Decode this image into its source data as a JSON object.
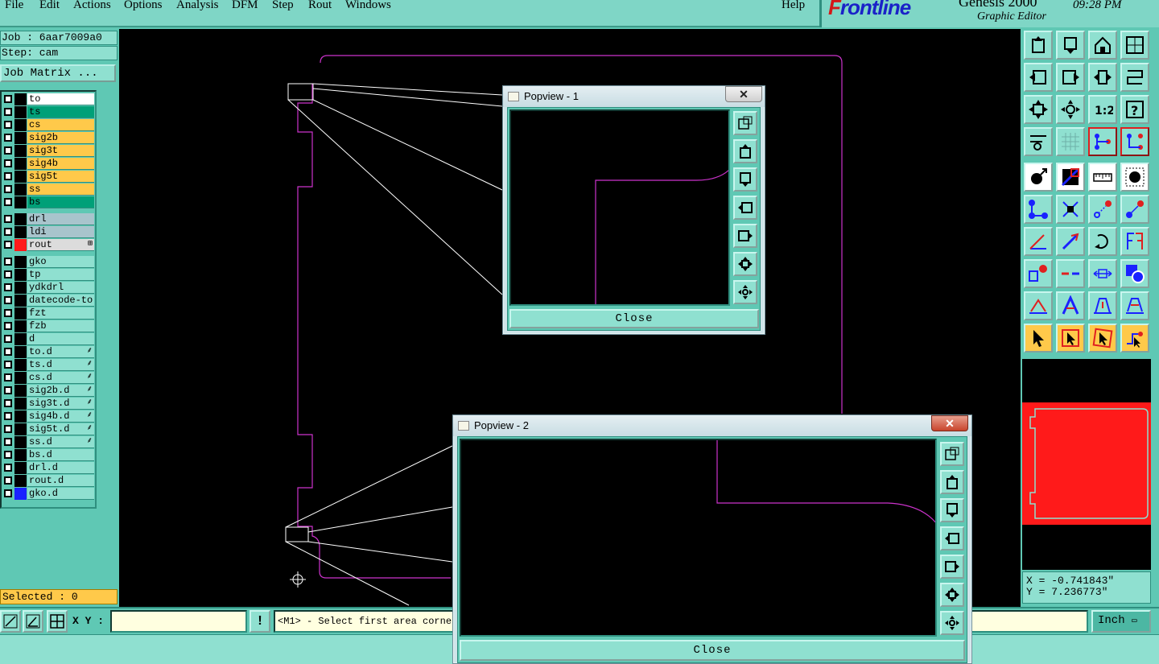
{
  "menubar": {
    "items": [
      {
        "label": "File",
        "u": "F"
      },
      {
        "label": "Edit",
        "u": "E"
      },
      {
        "label": "Actions",
        "u": "A"
      },
      {
        "label": "Options",
        "u": "O"
      },
      {
        "label": "Analysis",
        "u": "A"
      },
      {
        "label": "DFM",
        "u": "D"
      },
      {
        "label": "Step",
        "u": "S"
      },
      {
        "label": "Rout",
        "u": "R"
      },
      {
        "label": "Windows",
        "u": "W"
      }
    ],
    "help": "Help"
  },
  "brand": {
    "logo_f": "F",
    "logo_rest": "rontline",
    "product": "Genesis 2000",
    "subtitle": "Graphic Editor",
    "time": "09:28 PM"
  },
  "job": {
    "job_line": "Job : 6aar7009a0",
    "step_line": "Step: cam",
    "matrix_button": "Job Matrix ..."
  },
  "layers": [
    {
      "name": "to",
      "color": "#ffffff",
      "swatch": "#000000",
      "group": 0
    },
    {
      "name": "ts",
      "color": "#00a078",
      "swatch": "#000000",
      "group": 0
    },
    {
      "name": "cs",
      "color": "#ffc94a",
      "swatch": "#000000",
      "group": 0
    },
    {
      "name": "sig2b",
      "color": "#ffc94a",
      "swatch": "#000000",
      "group": 0
    },
    {
      "name": "sig3t",
      "color": "#ffc94a",
      "swatch": "#000000",
      "group": 0
    },
    {
      "name": "sig4b",
      "color": "#ffc94a",
      "swatch": "#000000",
      "group": 0
    },
    {
      "name": "sig5t",
      "color": "#ffc94a",
      "swatch": "#000000",
      "group": 0
    },
    {
      "name": "ss",
      "color": "#ffc94a",
      "swatch": "#000000",
      "group": 0
    },
    {
      "name": "bs",
      "color": "#00a078",
      "swatch": "#000000",
      "group": 0
    },
    {
      "name": "drl",
      "color": "#a8c4cc",
      "swatch": "#000000",
      "group": 1
    },
    {
      "name": "ldi",
      "color": "#a8c4cc",
      "swatch": "#000000",
      "group": 1
    },
    {
      "name": "rout",
      "color": "#dcdcdc",
      "swatch": "#ff1a1a",
      "group": 1,
      "marker": "⊞"
    },
    {
      "name": "gko",
      "color": "#8fe0d0",
      "swatch": "#000000",
      "group": 2
    },
    {
      "name": "tp",
      "color": "#8fe0d0",
      "swatch": "#000000",
      "group": 2
    },
    {
      "name": "ydkdrl",
      "color": "#8fe0d0",
      "swatch": "#000000",
      "group": 2
    },
    {
      "name": "datecode-to",
      "color": "#8fe0d0",
      "swatch": "#000000",
      "group": 2
    },
    {
      "name": "fzt",
      "color": "#8fe0d0",
      "swatch": "#000000",
      "group": 2
    },
    {
      "name": "fzb",
      "color": "#8fe0d0",
      "swatch": "#000000",
      "group": 2
    },
    {
      "name": "d",
      "color": "#8fe0d0",
      "swatch": "#000000",
      "group": 2
    },
    {
      "name": "to.d",
      "color": "#8fe0d0",
      "swatch": "#000000",
      "group": 2,
      "marker": "⸙"
    },
    {
      "name": "ts.d",
      "color": "#8fe0d0",
      "swatch": "#000000",
      "group": 2,
      "marker": "⸙"
    },
    {
      "name": "cs.d",
      "color": "#8fe0d0",
      "swatch": "#000000",
      "group": 2,
      "marker": "⸙"
    },
    {
      "name": "sig2b.d",
      "color": "#8fe0d0",
      "swatch": "#000000",
      "group": 2,
      "marker": "⸙"
    },
    {
      "name": "sig3t.d",
      "color": "#8fe0d0",
      "swatch": "#000000",
      "group": 2,
      "marker": "⸙"
    },
    {
      "name": "sig4b.d",
      "color": "#8fe0d0",
      "swatch": "#000000",
      "group": 2,
      "marker": "⸙"
    },
    {
      "name": "sig5t.d",
      "color": "#8fe0d0",
      "swatch": "#000000",
      "group": 2,
      "marker": "⸙"
    },
    {
      "name": "ss.d",
      "color": "#8fe0d0",
      "swatch": "#000000",
      "group": 2,
      "marker": "⸙"
    },
    {
      "name": "bs.d",
      "color": "#8fe0d0",
      "swatch": "#000000",
      "group": 2
    },
    {
      "name": "drl.d",
      "color": "#8fe0d0",
      "swatch": "#000000",
      "group": 2
    },
    {
      "name": "rout.d",
      "color": "#8fe0d0",
      "swatch": "#000000",
      "group": 2
    },
    {
      "name": "gko.d",
      "color": "#8fe0d0",
      "swatch": "#1a22ff",
      "group": 2
    }
  ],
  "selected_text": "Selected : 0",
  "coords": {
    "x_line": "X = -0.741843\"",
    "y_line": "Y = 7.236773\""
  },
  "bottom": {
    "xy_label": "X Y :",
    "xy_value": "",
    "prompt": "<M1> - Select first area corner",
    "units": "Inch"
  },
  "popview1": {
    "title": "Popview - 1",
    "close": "Close",
    "x": "✕"
  },
  "popview2": {
    "title": "Popview - 2",
    "close": "Close",
    "x": "✕"
  },
  "colors": {
    "outline": "#cc33cc",
    "connector": "#ffffff",
    "ui_teal": "#5fc8b4",
    "ui_light": "#8fe0d0",
    "highlight": "#ffc94a"
  }
}
